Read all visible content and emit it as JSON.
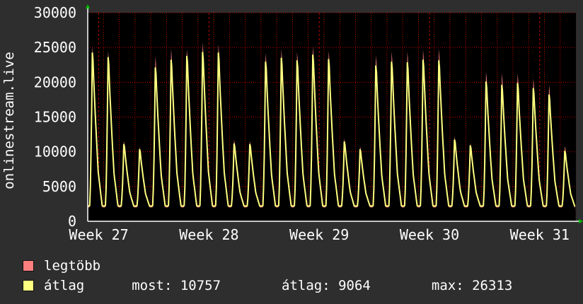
{
  "chart_data": {
    "type": "area",
    "title": "",
    "ylabel": "onlinestream.live",
    "xlabel": "",
    "ylim": [
      0,
      30000
    ],
    "yticks": [
      0,
      5000,
      10000,
      15000,
      20000,
      25000,
      30000
    ],
    "yticklabels": [
      "0",
      "5000",
      "10000",
      "15000",
      "20000",
      "25000",
      "30000"
    ],
    "xticklabels": [
      "Week 27",
      "Week 28",
      "Week 29",
      "Week 30",
      "Week 31"
    ],
    "grid": true,
    "days": 31,
    "series": [
      {
        "name": "legtöbb",
        "color": "#ff7f7f",
        "daily_peak": [
          27000,
          26300,
          12300,
          11400,
          25400,
          26600,
          26500,
          27600,
          27300,
          12500,
          12300,
          25900,
          26600,
          26100,
          27000,
          26300,
          12700,
          11500,
          25600,
          26200,
          26200,
          26500,
          26600,
          13000,
          12000,
          23000,
          22800,
          22800,
          22000,
          21000,
          11500
        ]
      },
      {
        "name": "átlag",
        "color": "#ffff80",
        "daily_peak": [
          26000,
          25300,
          11800,
          11000,
          23700,
          24900,
          25500,
          26100,
          26000,
          11900,
          11800,
          24600,
          25200,
          24800,
          25700,
          25000,
          12200,
          11000,
          24000,
          24600,
          24500,
          24900,
          24800,
          12500,
          11600,
          21500,
          21000,
          21300,
          20500,
          19500,
          10757
        ]
      }
    ],
    "baseline_min": 2200,
    "grid_color": "#c00000",
    "plot_bg": "#000000",
    "axis_color": "#ffffff",
    "arrow_color": "#00c000"
  },
  "legend": {
    "items": [
      {
        "label": "legtöbb",
        "color": "#ff7f7f"
      },
      {
        "label": "átlag",
        "color": "#ffff80"
      }
    ],
    "stats": {
      "now": "most: 10757",
      "avg": "átlag: 9064",
      "max": "max: 26313"
    }
  }
}
